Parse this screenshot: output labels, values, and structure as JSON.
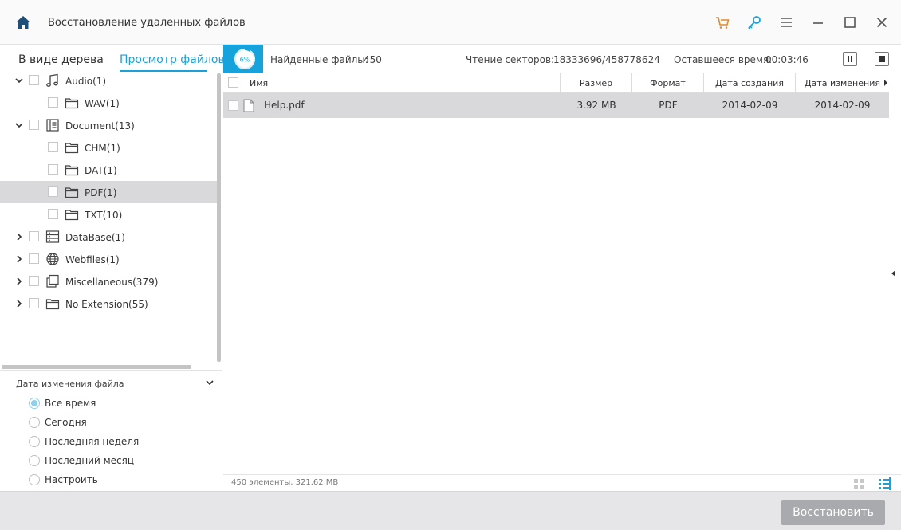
{
  "app": {
    "title": "Восстановление удаленных файлов"
  },
  "toolbar": {
    "icons": [
      "home-icon",
      "cart-icon",
      "key-icon",
      "menu-icon",
      "minimize-icon",
      "maximize-icon",
      "close-icon"
    ],
    "cart_color": "#e08a2e",
    "key_color": "#1ba0d8"
  },
  "status": {
    "tab_tree": "В виде дерева",
    "tab_files": "Просмотр файлов",
    "progress_label": "6%",
    "progress_percent": 6,
    "found_label": "Найденные файлы:",
    "found_value": "450",
    "sectors_label": "Чтение секторов:",
    "sectors_value": "18333696/458778624",
    "remaining_label": "Оставшееся время:",
    "remaining_value": "00:03:46",
    "accent": "#1ba0d8"
  },
  "tree": {
    "items": [
      {
        "label": "Audio(1)",
        "icon": "music-note-icon",
        "expanded": true
      },
      {
        "label": "WAV(1)",
        "icon": "folder-icon"
      },
      {
        "label": "Document(13)",
        "icon": "document-icon",
        "expanded": true
      },
      {
        "label": "CHM(1)",
        "icon": "folder-icon"
      },
      {
        "label": "DAT(1)",
        "icon": "folder-icon"
      },
      {
        "label": "PDF(1)",
        "icon": "folder-icon",
        "selected": true
      },
      {
        "label": "TXT(10)",
        "icon": "folder-icon"
      },
      {
        "label": "DataBase(1)",
        "icon": "database-icon",
        "expanded": false
      },
      {
        "label": "Webfiles(1)",
        "icon": "globe-icon",
        "expanded": false
      },
      {
        "label": "Miscellaneous(379)",
        "icon": "misc-files-icon",
        "expanded": false
      },
      {
        "label": "No Extension(55)",
        "icon": "folder-icon",
        "expanded": false
      }
    ]
  },
  "filter": {
    "title": "Дата изменения файла",
    "options": [
      "Все время",
      "Сегодня",
      "Последняя неделя",
      "Последний месяц",
      "Настроить"
    ],
    "selected": "Все время"
  },
  "table": {
    "columns": [
      "Имя",
      "Размер",
      "Формат",
      "Дата создания",
      "Дата изменения"
    ],
    "rows": [
      {
        "name": "Help.pdf",
        "size": "3.92 MB",
        "format": "PDF",
        "created": "2014-02-09",
        "modified": "2014-02-09"
      }
    ],
    "footer": "450 элементы, 321.62 MB"
  },
  "actions": {
    "restore": "Восстановить"
  }
}
